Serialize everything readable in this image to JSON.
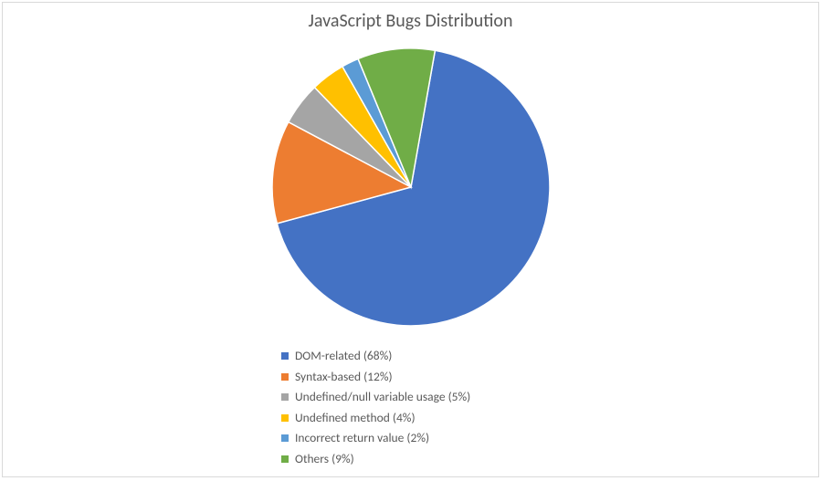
{
  "chart_data": {
    "type": "pie",
    "title": "JavaScript Bugs Distribution",
    "series": [
      {
        "name": "DOM-related",
        "value": 68,
        "label": "DOM-related (68%)",
        "color": "#4472C4"
      },
      {
        "name": "Syntax-based",
        "value": 12,
        "label": "Syntax-based (12%)",
        "color": "#ED7D31"
      },
      {
        "name": "Undefined/null variable usage",
        "value": 5,
        "label": "Undefined/null variable usage (5%)",
        "color": "#A5A5A5"
      },
      {
        "name": "Undefined method",
        "value": 4,
        "label": "Undefined method (4%)",
        "color": "#FFC000"
      },
      {
        "name": "Incorrect return value",
        "value": 2,
        "label": "Incorrect return value (2%)",
        "color": "#5B9BD5"
      },
      {
        "name": "Others",
        "value": 9,
        "label": "Others (9%)",
        "color": "#70AD47"
      }
    ],
    "start_angle_deg": -80
  }
}
